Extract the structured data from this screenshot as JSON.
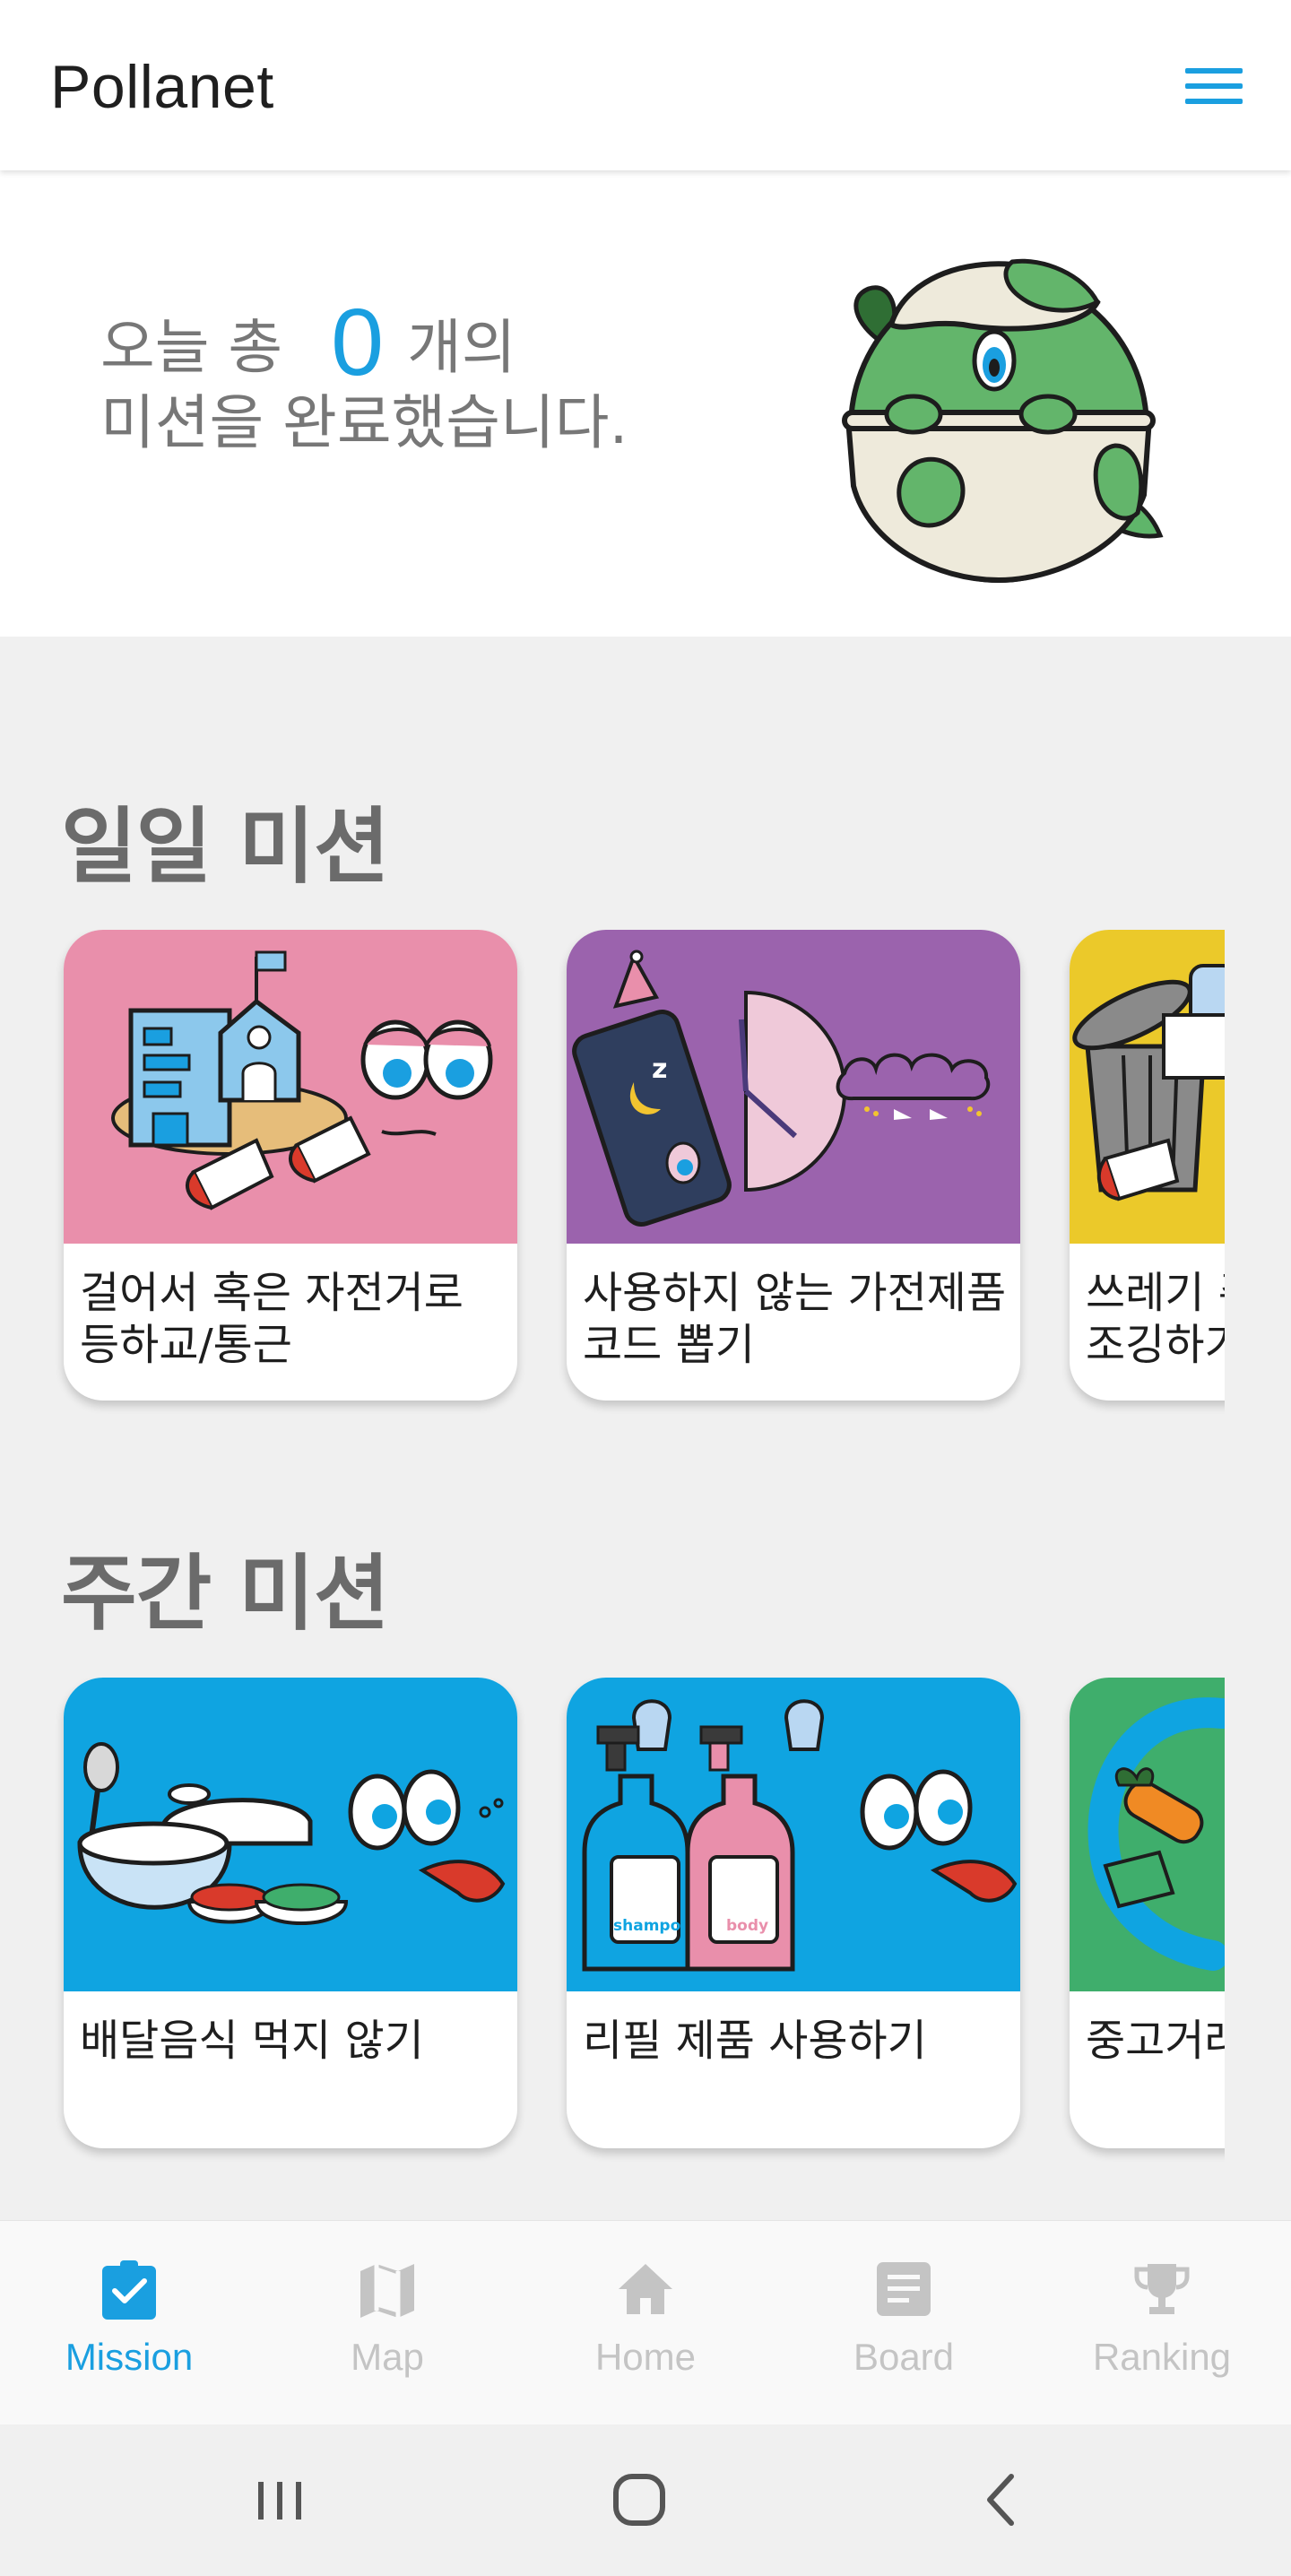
{
  "app": {
    "title": "Pollanet",
    "menu_icon": "hamburger-menu-icon"
  },
  "summary": {
    "prefix": "오늘 총",
    "count": "0",
    "unit": "개의",
    "line2": "미션을 완료했습니다."
  },
  "daily": {
    "title": "일일 미션",
    "cards": [
      {
        "label": "걸어서 혹은 자전거로\n등하교/통근",
        "art_bg": "#e98fab"
      },
      {
        "label": "사용하지 않는 가전제품\n코드 뽑기",
        "art_bg": "#9b63ad"
      },
      {
        "label": "쓰레기 주\n조깅하기",
        "art_bg": "#ebc92a"
      }
    ]
  },
  "weekly": {
    "title": "주간 미션",
    "cards": [
      {
        "label": "배달음식 먹지 않기",
        "art_bg": "#0fa4e1"
      },
      {
        "label": "리필 제품 사용하기",
        "art_bg": "#0fa4e1"
      },
      {
        "label": "중고거래",
        "art_bg": "#3fae6c"
      }
    ]
  },
  "art_text": {
    "shampoo": "shampoo",
    "body": "body"
  },
  "nav": {
    "items": [
      {
        "label": "Mission",
        "icon": "clipboard-check-icon",
        "active": true
      },
      {
        "label": "Map",
        "icon": "map-icon",
        "active": false
      },
      {
        "label": "Home",
        "icon": "home-icon",
        "active": false
      },
      {
        "label": "Board",
        "icon": "article-icon",
        "active": false
      },
      {
        "label": "Ranking",
        "icon": "trophy-icon",
        "active": false
      }
    ]
  },
  "system_nav": [
    "recent-apps-icon",
    "home-circle-icon",
    "back-icon"
  ],
  "colors": {
    "accent": "#1a9fe0",
    "inactive": "#c4c4c4",
    "section_title": "#6b6b6b"
  }
}
